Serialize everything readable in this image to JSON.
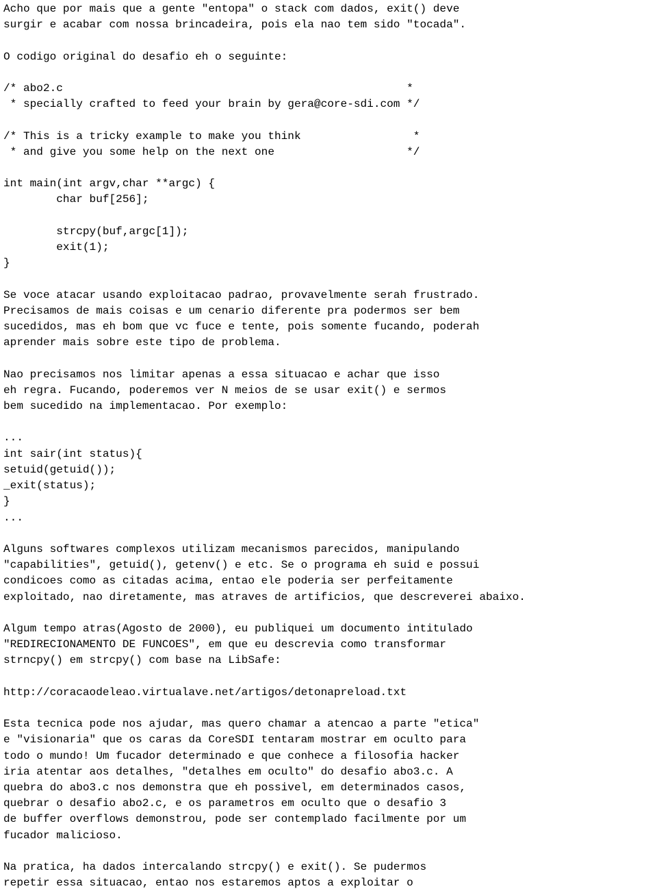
{
  "document": {
    "kind": "plain-text-article",
    "language": "pt-BR",
    "background_color": "#ffffff",
    "text_color": "#000000",
    "font_style": "monospace",
    "blocks": [
      {
        "id": "intro-paragraph",
        "type": "paragraph",
        "lines": [
          "Acho que por mais que a gente \"entopa\" o stack com dados, exit() deve",
          "surgir e acabar com nossa brincadeira, pois ela nao tem sido \"tocada\"."
        ]
      },
      {
        "id": "blank-1",
        "type": "blank",
        "lines": [
          ""
        ]
      },
      {
        "id": "code-intro",
        "type": "paragraph",
        "lines": [
          "O codigo original do desafio eh o seguinte:"
        ]
      },
      {
        "id": "blank-2",
        "type": "blank",
        "lines": [
          ""
        ]
      },
      {
        "id": "code-abo2-header",
        "type": "code",
        "lines": [
          "/* abo2.c                                                    *",
          " * specially crafted to feed your brain by gera@core-sdi.com */"
        ]
      },
      {
        "id": "blank-3",
        "type": "blank",
        "lines": [
          ""
        ]
      },
      {
        "id": "code-abo2-hint",
        "type": "code",
        "lines": [
          "/* This is a tricky example to make you think                 *",
          " * and give you some help on the next one                    */"
        ]
      },
      {
        "id": "blank-4",
        "type": "blank",
        "lines": [
          ""
        ]
      },
      {
        "id": "code-abo2-main",
        "type": "code",
        "lines": [
          "int main(int argv,char **argc) {",
          "        char buf[256];",
          "",
          "        strcpy(buf,argc[1]);",
          "        exit(1);",
          "}"
        ]
      },
      {
        "id": "blank-5",
        "type": "blank",
        "lines": [
          ""
        ]
      },
      {
        "id": "paragraph-exploitacao",
        "type": "paragraph",
        "lines": [
          "Se voce atacar usando exploitacao padrao, provavelmente serah frustrado.",
          "Precisamos de mais coisas e um cenario diferente pra podermos ser bem",
          "sucedidos, mas eh bom que vc fuce e tente, pois somente fucando, poderah",
          "aprender mais sobre este tipo de problema."
        ]
      },
      {
        "id": "blank-6",
        "type": "blank",
        "lines": [
          ""
        ]
      },
      {
        "id": "paragraph-nao-precisamos",
        "type": "paragraph",
        "lines": [
          "Nao precisamos nos limitar apenas a essa situacao e achar que isso",
          "eh regra. Fucando, poderemos ver N meios de se usar exit() e sermos",
          "bem sucedido na implementacao. Por exemplo:"
        ]
      },
      {
        "id": "blank-7",
        "type": "blank",
        "lines": [
          ""
        ]
      },
      {
        "id": "code-sair",
        "type": "code",
        "lines": [
          "...",
          "int sair(int status){",
          "setuid(getuid());",
          "_exit(status);",
          "}",
          "..."
        ]
      },
      {
        "id": "blank-8",
        "type": "blank",
        "lines": [
          ""
        ]
      },
      {
        "id": "paragraph-softwares",
        "type": "paragraph",
        "lines": [
          "Alguns softwares complexos utilizam mecanismos parecidos, manipulando",
          "\"capabilities\", getuid(), getenv() e etc. Se o programa eh suid e possui",
          "condicoes como as citadas acima, entao ele poderia ser perfeitamente",
          "exploitado, nao diretamente, mas atraves de artificios, que descreverei abaixo."
        ]
      },
      {
        "id": "blank-9",
        "type": "blank",
        "lines": [
          ""
        ]
      },
      {
        "id": "paragraph-algum-tempo",
        "type": "paragraph",
        "lines": [
          "Algum tempo atras(Agosto de 2000), eu publiquei um documento intitulado",
          "\"REDIRECIONAMENTO DE FUNCOES\", em que eu descrevia como transformar",
          "strncpy() em strcpy() com base na LibSafe:"
        ]
      },
      {
        "id": "blank-10",
        "type": "blank",
        "lines": [
          ""
        ]
      },
      {
        "id": "link-detonapreload",
        "type": "url",
        "lines": [
          "http://coracaodeleao.virtualave.net/artigos/detonapreload.txt"
        ]
      },
      {
        "id": "blank-11",
        "type": "blank",
        "lines": [
          ""
        ]
      },
      {
        "id": "paragraph-etica",
        "type": "paragraph",
        "lines": [
          "Esta tecnica pode nos ajudar, mas quero chamar a atencao a parte \"etica\"",
          "e \"visionaria\" que os caras da CoreSDI tentaram mostrar em oculto para",
          "todo o mundo! Um fucador determinado e que conhece a filosofia hacker",
          "iria atentar aos detalhes, \"detalhes em oculto\" do desafio abo3.c. A",
          "quebra do abo3.c nos demonstra que eh possivel, em determinados casos,",
          "quebrar o desafio abo2.c, e os parametros em oculto que o desafio 3",
          "de buffer overflows demonstrou, pode ser contemplado facilmente por um",
          "fucador malicioso."
        ]
      },
      {
        "id": "blank-12",
        "type": "blank",
        "lines": [
          ""
        ]
      },
      {
        "id": "paragraph-na-pratica",
        "type": "paragraph",
        "lines": [
          "Na pratica, ha dados intercalando strcpy() e exit(). Se pudermos",
          "repetir essa situacao, entao nos estaremos aptos a exploitar o"
        ]
      }
    ]
  }
}
